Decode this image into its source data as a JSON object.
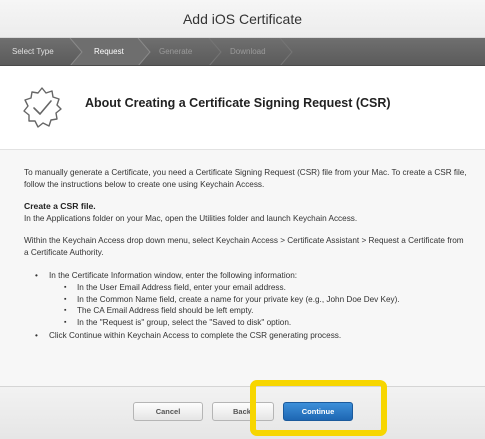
{
  "window": {
    "title": "Add iOS Certificate"
  },
  "steps": [
    {
      "label": "Select Type",
      "state": "done"
    },
    {
      "label": "Request",
      "state": "active"
    },
    {
      "label": "Generate",
      "state": "inactive"
    },
    {
      "label": "Download",
      "state": "inactive"
    }
  ],
  "header": {
    "icon": "certificate-seal-icon",
    "title": "About Creating a Certificate Signing Request (CSR)"
  },
  "body": {
    "intro": "To manually generate a Certificate, you need a Certificate Signing Request (CSR) file from your Mac. To create a CSR file, follow the instructions below to create one using Keychain Access.",
    "section_title": "Create a CSR file.",
    "section_text": "In the Applications folder on your Mac, open the Utilities folder and launch Keychain Access.",
    "menu_text": "Within the Keychain Access drop down menu, select Keychain Access > Certificate Assistant > Request a Certificate from a Certificate Authority.",
    "bullet1": "In the Certificate Information window, enter the following information:",
    "sub_bullets": [
      "In the User Email Address field, enter your email address.",
      "In the Common Name field, create a name for your private key (e.g., John Doe Dev Key).",
      "The CA Email Address field should be left empty.",
      "In the \"Request is\" group, select the \"Saved to disk\" option."
    ],
    "bullet2": "Click Continue within Keychain Access to complete the CSR generating process."
  },
  "footer": {
    "cancel_label": "Cancel",
    "back_label": "Back",
    "continue_label": "Continue"
  },
  "colors": {
    "highlight": "#f7d600",
    "primary_button": "#1e67b3"
  }
}
